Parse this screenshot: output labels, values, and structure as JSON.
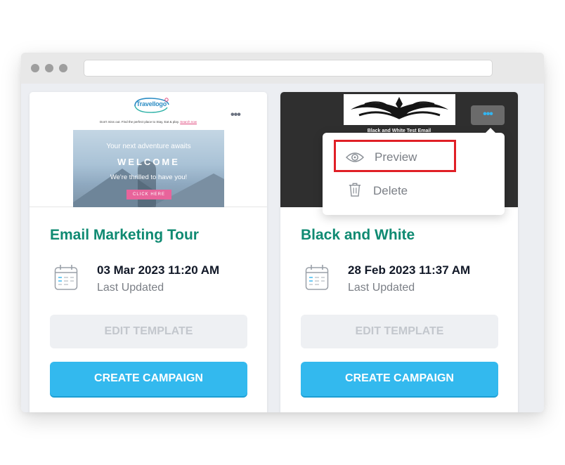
{
  "cards": [
    {
      "title": "Email Marketing Tour",
      "date": "03 Mar 2023 11:20 AM",
      "date_label": "Last Updated",
      "edit_label": "EDIT TEMPLATE",
      "create_label": "CREATE CAMPAIGN",
      "preview": {
        "logo": "Travellogo",
        "tagline": "Don't miss out. Find the perfect place to Stay, Eat & play.",
        "tagline_link": "Search now",
        "hero_sub": "Your next adventure awaits",
        "hero_title": "WELCOME",
        "hero_msg": "We're thrilled to have you!",
        "hero_button": "CLICK HERE"
      }
    },
    {
      "title": "Black and White",
      "date": "28 Feb 2023 11:37 AM",
      "date_label": "Last Updated",
      "edit_label": "EDIT TEMPLATE",
      "create_label": "CREATE CAMPAIGN",
      "preview": {
        "caption": "Black and White Test Email"
      }
    }
  ],
  "dropdown": {
    "items": [
      {
        "label": "Preview",
        "icon": "eye-icon"
      },
      {
        "label": "Delete",
        "icon": "trash-icon"
      }
    ]
  },
  "more_icon": "•••",
  "colors": {
    "title": "#0f8a72",
    "primary_button": "#33b9ee",
    "highlight_box": "#e01f26",
    "active_dots": "#33b5f0"
  }
}
